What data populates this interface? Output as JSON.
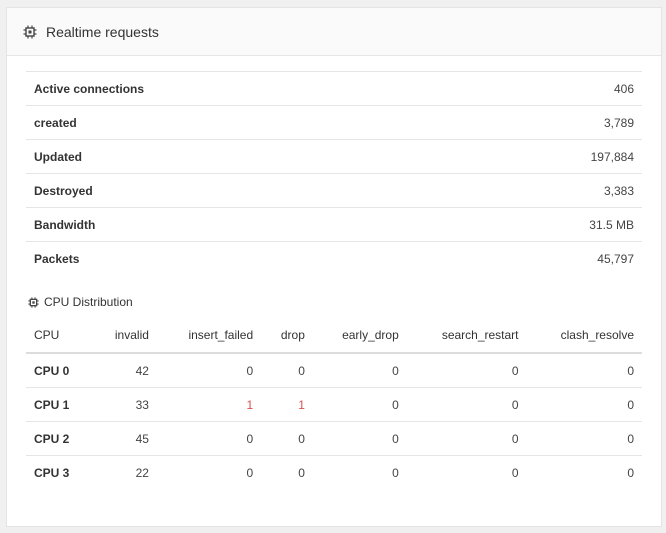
{
  "header": {
    "title": "Realtime requests",
    "icon": "chip-icon"
  },
  "stats": [
    {
      "label": "Active connections",
      "value": "406"
    },
    {
      "label": "created",
      "value": "3,789"
    },
    {
      "label": "Updated",
      "value": "197,884"
    },
    {
      "label": "Destroyed",
      "value": "3,383"
    },
    {
      "label": "Bandwidth",
      "value": "31.5 MB"
    },
    {
      "label": "Packets",
      "value": "45,797"
    }
  ],
  "cpu_section": {
    "title": "CPU Distribution",
    "columns": [
      "CPU",
      "invalid",
      "insert_failed",
      "drop",
      "early_drop",
      "search_restart",
      "clash_resolve"
    ],
    "rows": [
      [
        "CPU 0",
        "42",
        "0",
        "0",
        "0",
        "0",
        "0"
      ],
      [
        "CPU 1",
        "33",
        "1",
        "1",
        "0",
        "0",
        "0"
      ],
      [
        "CPU 2",
        "45",
        "0",
        "0",
        "0",
        "0",
        "0"
      ],
      [
        "CPU 3",
        "22",
        "0",
        "0",
        "0",
        "0",
        "0"
      ]
    ]
  },
  "colors": {
    "warning": "#d9534f"
  }
}
